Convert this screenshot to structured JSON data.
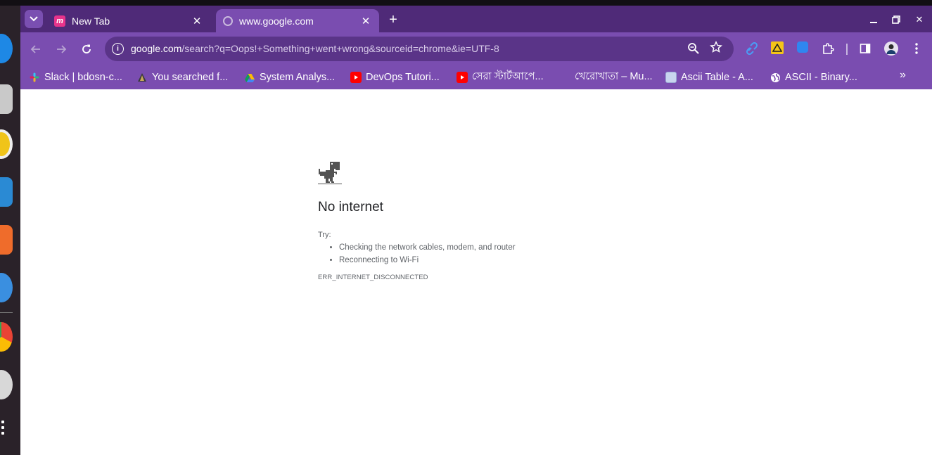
{
  "tabs": [
    {
      "title": "New Tab",
      "favicon": "m-icon",
      "active": false
    },
    {
      "title": "www.google.com",
      "favicon": "globe-icon",
      "active": true
    }
  ],
  "tab_controls": {
    "close": "✕",
    "new_tab": "+",
    "tab_search": "⌄"
  },
  "window_controls": {
    "minimize": "—",
    "maximize": "⧉",
    "close": "✕"
  },
  "omnibox": {
    "host": "google.com",
    "path": "/search?q=Oops!+Something+went+wrong&sourceid=chrome&ie=UTF-8"
  },
  "extensions": [
    "link-icon",
    "artstation-icon",
    "blue-square-icon",
    "puzzle-icon"
  ],
  "bookmarks": [
    {
      "label": "Slack | bdosn-c...",
      "icon": "slack-icon"
    },
    {
      "label": "You searched f...",
      "icon": "prism-icon"
    },
    {
      "label": "System Analys...",
      "icon": "drive-icon"
    },
    {
      "label": "DevOps Tutori...",
      "icon": "youtube-icon"
    },
    {
      "label": "সেরা স্টার্টআপে...",
      "icon": "youtube-icon"
    },
    {
      "label": "খেরোখাতা – Mu...",
      "icon": "blank-icon"
    },
    {
      "label": "Ascii Table - A...",
      "icon": "page-icon"
    },
    {
      "label": "ASCII - Binary...",
      "icon": "globe-icon"
    }
  ],
  "bookmarks_more": "»",
  "error_page": {
    "title": "No internet",
    "try_label": "Try:",
    "suggestions": [
      "Checking the network cables, modem, and router",
      "Reconnecting to Wi-Fi"
    ],
    "error_code": "ERR_INTERNET_DISCONNECTED"
  },
  "colors": {
    "tabbar": "#4f2a78",
    "toolbar": "#7a4db0",
    "omnibox": "#5a3488",
    "page_background": "#ffffff",
    "title_text": "#202124",
    "secondary_text": "#5f6368"
  }
}
